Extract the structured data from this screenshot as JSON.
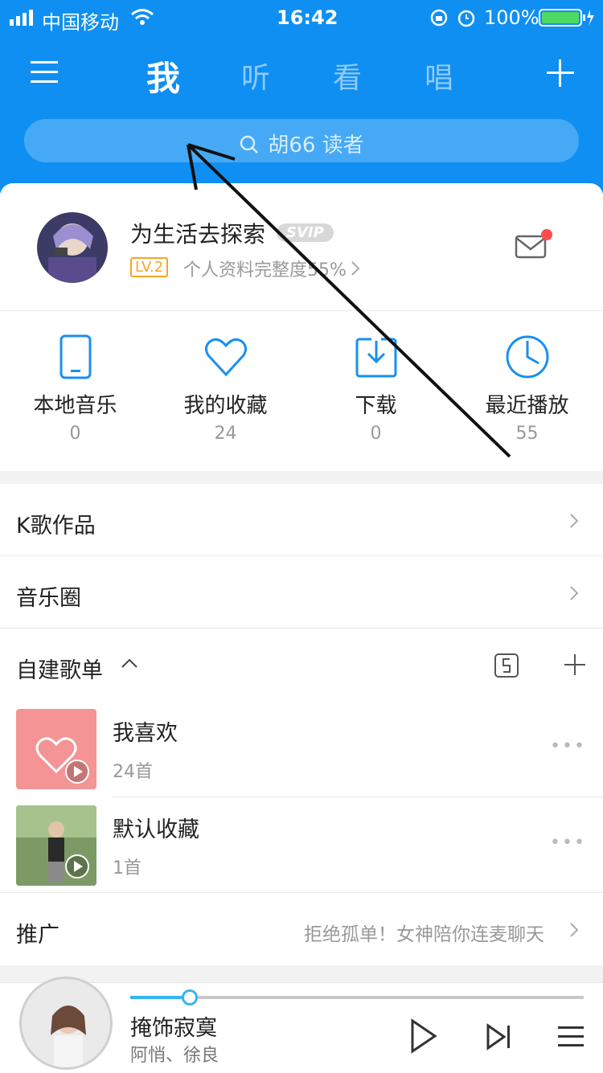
{
  "status": {
    "carrier": "中国移动",
    "time": "16:42",
    "battery": "100%"
  },
  "tabs": [
    "我",
    "听",
    "看",
    "唱"
  ],
  "search": {
    "text": "胡66 读者"
  },
  "profile": {
    "name": "为生活去探索",
    "badge": "SVIP",
    "level": "LV.2",
    "progress": "个人资料完整度55%"
  },
  "quick": [
    {
      "label": "本地音乐",
      "count": "0"
    },
    {
      "label": "我的收藏",
      "count": "24"
    },
    {
      "label": "下载",
      "count": "0"
    },
    {
      "label": "最近播放",
      "count": "55"
    }
  ],
  "rows": {
    "karaoke": "K歌作品",
    "circle": "音乐圈"
  },
  "playlists": {
    "header": "自建歌单",
    "items": [
      {
        "title": "我喜欢",
        "count": "24首"
      },
      {
        "title": "默认收藏",
        "count": "1首"
      }
    ]
  },
  "promo": {
    "label": "推广",
    "text": "拒绝孤单！女神陪你连麦聊天"
  },
  "player": {
    "song": "掩饰寂寞",
    "artist": "阿悄、徐良"
  },
  "colors": {
    "brand": "#0f8ff2",
    "accent": "#35b5f1",
    "favorite": "#f49494"
  }
}
